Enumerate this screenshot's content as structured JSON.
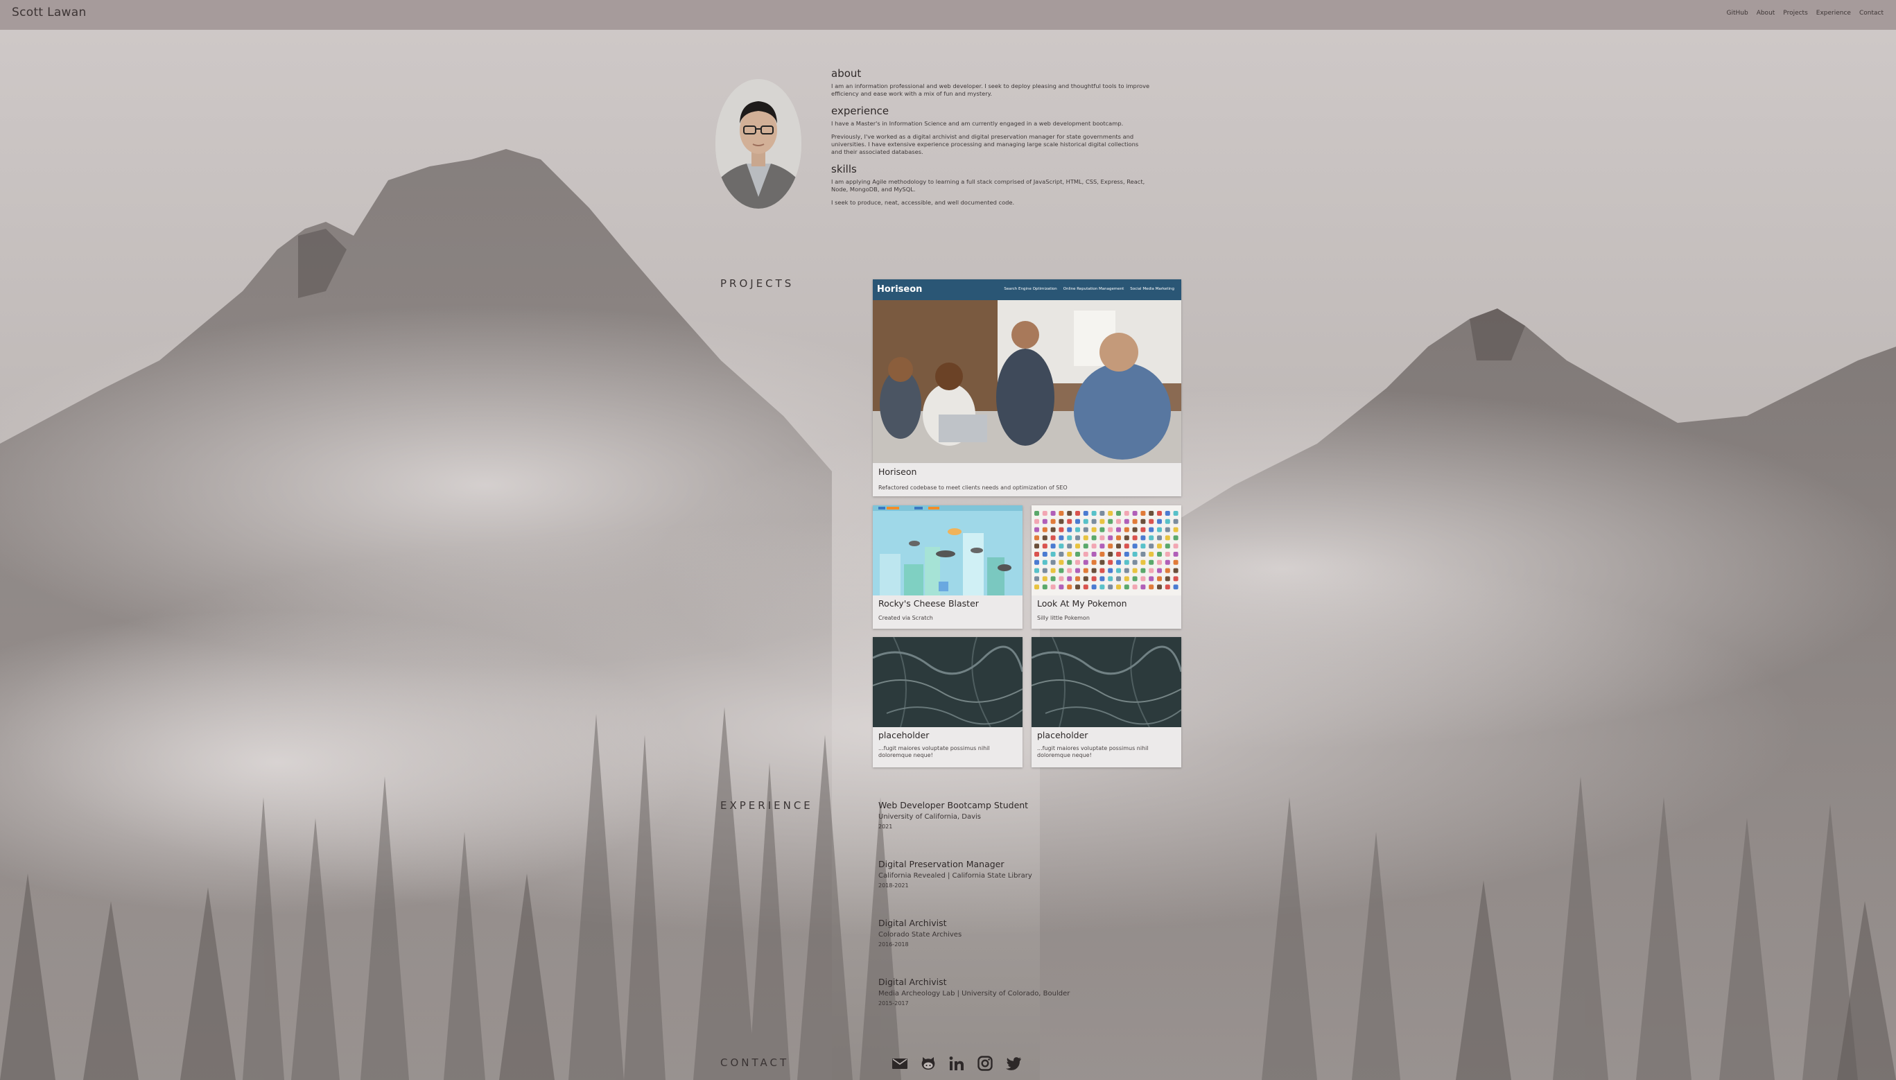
{
  "brand": "Scott Lawan",
  "nav": [
    "GitHub",
    "About",
    "Projects",
    "Experience",
    "Contact"
  ],
  "about": {
    "heading": "about",
    "text": "I am an information professional and web developer. I seek to deploy pleasing and thoughtful tools to improve efficiency and ease work with a mix of fun and mystery."
  },
  "experience_summary": {
    "heading": "experience",
    "p1": "I have a Master's in Information Science and am currently engaged in a web development bootcamp.",
    "p2": "Previously, I've worked as a digital archivist and digital preservation manager for state governments and universities. I have extensive experience processing and managing large scale historical digital collections and their associated databases."
  },
  "skills": {
    "heading": "skills",
    "p1": "I am applying Agile methodology to learning a full stack comprised of JavaScript, HTML, CSS, Express, React, Node, MongoDB, and MySQL.",
    "p2": "I seek to produce, neat, accessible, and well documented code."
  },
  "sections": {
    "projects": "PROJECTS",
    "experience": "EXPERIENCE",
    "contact": "CONTACT"
  },
  "projects": [
    {
      "title": "Horiseon",
      "desc": "Refactored codebase to meet clients needs and optimization of SEO",
      "thumb": {
        "brand": "Horiseon",
        "links": [
          "Search Engine Optimization",
          "Online Reputation Management",
          "Social Media Marketing"
        ]
      }
    },
    {
      "title": "Rocky's Cheese Blaster",
      "desc": "Created via Scratch"
    },
    {
      "title": "Look At My Pokemon",
      "desc": "Silly little Pokemon"
    },
    {
      "title": "placeholder",
      "desc": "...fugit maiores voluptate possimus nihil doloremque neque!"
    },
    {
      "title": "placeholder",
      "desc": "...fugit maiores voluptate possimus nihil doloremque neque!"
    }
  ],
  "experience": [
    {
      "role": "Web Developer Bootcamp Student",
      "org": "University of California, Davis",
      "years": "2021"
    },
    {
      "role": "Digital Preservation Manager",
      "org": "California Revealed | California State Library",
      "years": "2018-2021"
    },
    {
      "role": "Digital Archivist",
      "org": "Colorado State Archives",
      "years": "2016-2018"
    },
    {
      "role": "Digital Archivist",
      "org": "Media Archeology Lab | University of Colorado, Boulder",
      "years": "2015-2017"
    }
  ],
  "contact_icons": [
    "email-icon",
    "github-icon",
    "linkedin-icon",
    "instagram-icon",
    "twitter-icon"
  ],
  "colors": {
    "navbar": "#a69b9b",
    "card": "#eceaea",
    "horiseon_header": "#2a5675",
    "text": "#3a3535"
  }
}
